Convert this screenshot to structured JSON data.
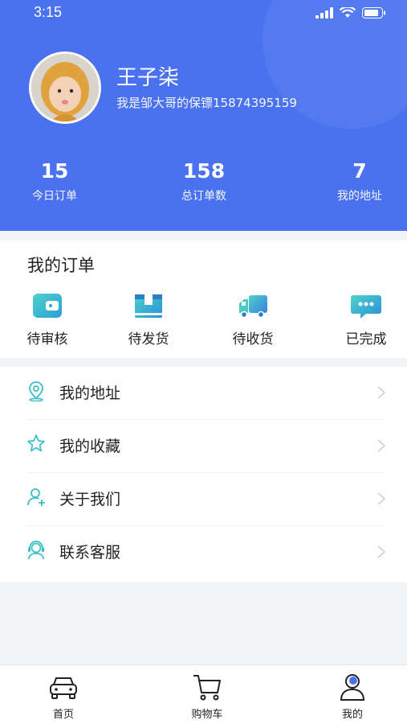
{
  "status_bar": {
    "time": "3:15"
  },
  "profile": {
    "name": "王子柒",
    "subtitle": "我是邹大哥的保镖15874395159"
  },
  "stats": [
    {
      "value": "15",
      "label": "今日订单"
    },
    {
      "value": "158",
      "label": "总订单数"
    },
    {
      "value": "7",
      "label": "我的地址"
    }
  ],
  "orders": {
    "title": "我的订单",
    "items": [
      {
        "label": "待审核",
        "icon": "wallet-icon"
      },
      {
        "label": "待发货",
        "icon": "box-icon"
      },
      {
        "label": "待收货",
        "icon": "truck-icon"
      },
      {
        "label": "已完成",
        "icon": "chat-bubble-icon"
      }
    ]
  },
  "menu": [
    {
      "label": "我的地址",
      "icon": "location-pin-icon"
    },
    {
      "label": "我的收藏",
      "icon": "star-icon"
    },
    {
      "label": "关于我们",
      "icon": "user-add-icon"
    },
    {
      "label": "联系客服",
      "icon": "headset-icon"
    }
  ],
  "tabbar": [
    {
      "label": "首页",
      "icon": "car-icon"
    },
    {
      "label": "购物车",
      "icon": "cart-icon"
    },
    {
      "label": "我的",
      "icon": "profile-icon"
    }
  ],
  "colors": {
    "header_bg": "#4a72f0",
    "icon_teal": "#3bbfc6",
    "icon_blue": "#3a8fe0"
  }
}
